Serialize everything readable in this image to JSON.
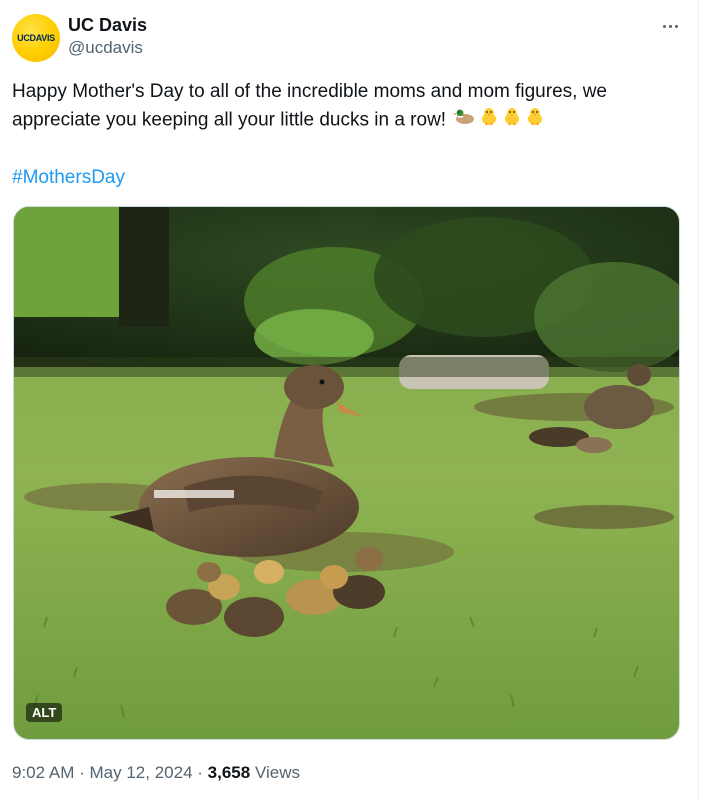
{
  "account": {
    "display_name": "UC Davis",
    "handle": "@ucdavis",
    "avatar_text": "UCDAVIS",
    "avatar_color": "#ffcd00",
    "brand_text_color": "#022851"
  },
  "menu": {
    "more_icon": "more-horizontal-icon"
  },
  "tweet": {
    "text_line1": "Happy Mother's Day to all of the incredible moms and mom figures, we",
    "text_line2": "appreciate you keeping all your little ducks in a row!",
    "emojis": [
      "duck-emoji",
      "baby-chick-emoji",
      "baby-chick-emoji",
      "baby-chick-emoji"
    ],
    "hashtag": "#MothersDay",
    "hashtag_color": "#1d9bf0"
  },
  "media": {
    "alt_label": "ALT"
  },
  "meta": {
    "time": "9:02 AM",
    "separator": "·",
    "date": "May 12, 2024",
    "views_count": "3,658",
    "views_label": "Views"
  }
}
